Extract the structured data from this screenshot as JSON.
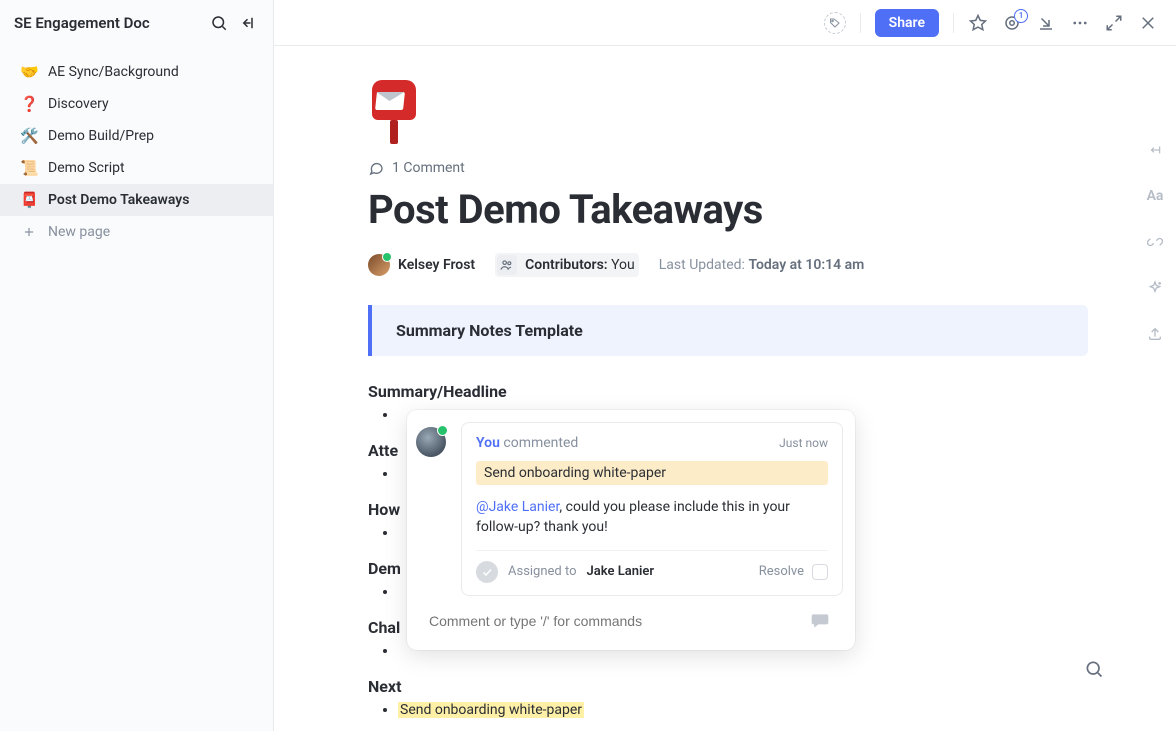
{
  "sidebar": {
    "title": "SE Engagement Doc",
    "items": [
      {
        "emoji": "🤝",
        "label": "AE Sync/Background",
        "active": false
      },
      {
        "emoji": "❓",
        "label": "Discovery",
        "active": false
      },
      {
        "emoji": "🛠️",
        "label": "Demo Build/Prep",
        "active": false
      },
      {
        "emoji": "📜",
        "label": "Demo Script",
        "active": false
      },
      {
        "emoji": "📮",
        "label": "Post Demo Takeaways",
        "active": true
      }
    ],
    "new_page_label": "New page"
  },
  "topbar": {
    "share_label": "Share",
    "notification_count": "1"
  },
  "right_rail": {
    "text_style_label": "Aa"
  },
  "doc": {
    "comment_count_label": "1 Comment",
    "title": "Post Demo Takeaways",
    "owner": "Kelsey Frost",
    "contributors_label": "Contributors:",
    "contributors_value": "You",
    "updated_label": "Last Updated:",
    "updated_value": "Today at 10:14 am",
    "callout": "Summary Notes Template",
    "sections": [
      "Summary/Headline",
      "Atte",
      "How",
      "Dem",
      "Chal",
      "Next"
    ],
    "highlighted_item": "Send onboarding white-paper"
  },
  "comment_popup": {
    "author": "You",
    "action": "commented",
    "time": "Just now",
    "quoted_text": "Send onboarding white-paper",
    "mention": "@Jake Lanier",
    "body_rest": ", could you please include this in your follow-up? thank you!",
    "assigned_label": "Assigned to",
    "assigned_to": "Jake Lanier",
    "resolve_label": "Resolve",
    "input_placeholder": "Comment or type '/' for commands"
  }
}
